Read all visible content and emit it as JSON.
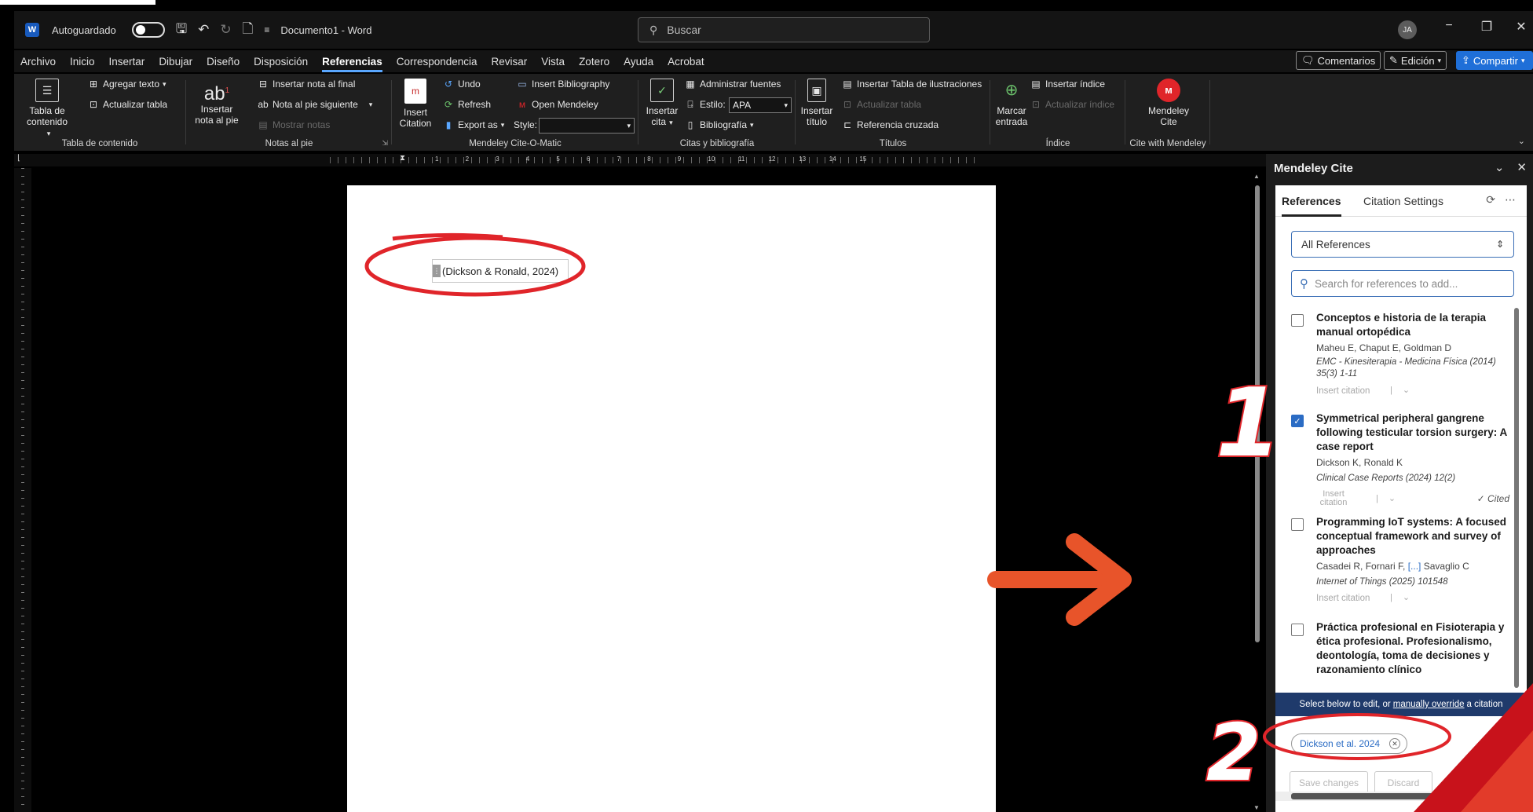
{
  "titlebar": {
    "autosave_label": "Autoguardado",
    "doc_title": "Documento1 - Word",
    "search_placeholder": "Buscar",
    "avatar_initials": "JA"
  },
  "menubar": {
    "tabs": [
      "Archivo",
      "Inicio",
      "Insertar",
      "Dibujar",
      "Diseño",
      "Disposición",
      "Referencias",
      "Correspondencia",
      "Revisar",
      "Vista",
      "Zotero",
      "Ayuda",
      "Acrobat"
    ],
    "active_tab": "Referencias",
    "comments_label": "Comentarios",
    "editing_label": "Edición",
    "share_label": "Compartir"
  },
  "ribbon": {
    "toc": {
      "big_label_1": "Tabla de",
      "big_label_2": "contenido",
      "add_text": "Agregar texto",
      "update_table": "Actualizar tabla",
      "group": "Tabla de contenido"
    },
    "footnotes": {
      "big_label_1": "Insertar",
      "big_label_2": "nota al pie",
      "endnote": "Insertar nota al final",
      "next_footnote": "Nota al pie siguiente",
      "show_notes": "Mostrar notas",
      "group": "Notas al pie"
    },
    "cite_o_matic": {
      "big_label_1": "Insert",
      "big_label_2": "Citation",
      "undo": "Undo",
      "refresh": "Refresh",
      "export_as": "Export as",
      "insert_bibliography": "Insert Bibliography",
      "open_mendeley": "Open Mendeley",
      "style_label": "Style:",
      "style_value": "",
      "group": "Mendeley Cite-O-Matic"
    },
    "citations": {
      "big_label_1": "Insertar",
      "big_label_2": "cita",
      "manage_sources": "Administrar fuentes",
      "style_label": "Estilo:",
      "style_value": "APA",
      "bibliography": "Bibliografía",
      "group": "Citas y bibliografía"
    },
    "captions": {
      "big_label_1": "Insertar",
      "big_label_2": "título",
      "table_of_figures": "Insertar Tabla de ilustraciones",
      "update_table": "Actualizar tabla",
      "cross_reference": "Referencia cruzada",
      "group": "Títulos"
    },
    "index": {
      "big_label_1": "Marcar",
      "big_label_2": "entrada",
      "insert_index": "Insertar índice",
      "update_index": "Actualizar índice",
      "group": "Índice"
    },
    "mendeley": {
      "big_label_1": "Mendeley",
      "big_label_2": "Cite",
      "group": "Cite with Mendeley"
    }
  },
  "ruler": {
    "numbers": [
      "1",
      "2",
      "3",
      "4",
      "5",
      "6",
      "7",
      "8",
      "9",
      "10",
      "11",
      "12",
      "13",
      "14",
      "15"
    ]
  },
  "document": {
    "citation_text": "(Dickson & Ronald, 2024)"
  },
  "mendeley_pane": {
    "title": "Mendeley Cite",
    "tabs": {
      "references": "References",
      "citation_settings": "Citation Settings"
    },
    "library_select": "All References",
    "search_placeholder": "Search for references to add...",
    "references": [
      {
        "title": "Conceptos e historia de la terapia manual ortopédica",
        "authors": "Maheu E, Chaput E, Goldman D",
        "journal": "EMC - Kinesiterapia - Medicina Física (2014) 35(3) 1-11",
        "insert": "Insert citation",
        "checked": false,
        "cited": ""
      },
      {
        "title": "Symmetrical peripheral gangrene following testicular torsion surgery: A case report",
        "authors": "Dickson K, Ronald K",
        "journal": "Clinical Case Reports (2024) 12(2)",
        "insert_line1": "Insert",
        "insert_line2": "citation",
        "checked": true,
        "cited": "Cited"
      },
      {
        "title": "Programming IoT systems: A focused conceptual framework and survey of approaches",
        "authors_pre": "Casadei R, Fornari F, ",
        "authors_ellipsis": "[...]",
        "authors_post": " Savaglio C",
        "journal": "Internet of Things (2025) 101548",
        "insert": "Insert citation",
        "checked": false,
        "cited": ""
      },
      {
        "title": "Práctica profesional en Fisioterapia y ética profesional. Profesionalismo, deontología, toma de decisiones y razonamiento clínico",
        "checked": false
      }
    ],
    "banner_pre": "Select below to edit, or",
    "banner_link": "manually override",
    "banner_post": "a citation",
    "chip_label": "Dickson et al. 2024",
    "save_label": "Save changes",
    "discard_label": "Discard"
  },
  "annotations": {
    "number_1": "1",
    "number_2": "2"
  },
  "colors": {
    "annotation_red": "#e0252a",
    "arrow_orange": "#e8542a",
    "mendeley_red": "#e0252a",
    "share_blue": "#1f6fd8",
    "accent_blue": "#2b6cc4"
  }
}
